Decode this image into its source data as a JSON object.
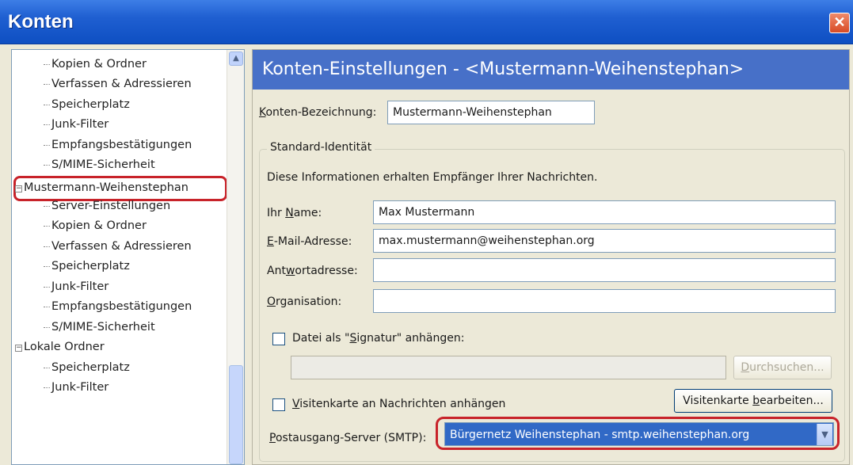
{
  "window": {
    "title": "Konten",
    "close_symbol": "✕"
  },
  "tree": {
    "items": [
      {
        "label": "Kopien & Ordner",
        "level": 1
      },
      {
        "label": "Verfassen & Adressieren",
        "level": 1
      },
      {
        "label": "Speicherplatz",
        "level": 1
      },
      {
        "label": "Junk-Filter",
        "level": 1
      },
      {
        "label": "Empfangsbestätigungen",
        "level": 1
      },
      {
        "label": "S/MIME-Sicherheit",
        "level": 1
      },
      {
        "label": "Mustermann-Weihenstephan",
        "level": 0,
        "expanded": true,
        "selected": true
      },
      {
        "label": "Server-Einstellungen",
        "level": 1
      },
      {
        "label": "Kopien & Ordner",
        "level": 1
      },
      {
        "label": "Verfassen & Adressieren",
        "level": 1
      },
      {
        "label": "Speicherplatz",
        "level": 1
      },
      {
        "label": "Junk-Filter",
        "level": 1
      },
      {
        "label": "Empfangsbestätigungen",
        "level": 1
      },
      {
        "label": "S/MIME-Sicherheit",
        "level": 1
      },
      {
        "label": "Lokale Ordner",
        "level": 0,
        "expanded": true
      },
      {
        "label": "Speicherplatz",
        "level": 1
      },
      {
        "label": "Junk-Filter",
        "level": 1
      }
    ],
    "expander_symbol": "−"
  },
  "settings": {
    "header": "Konten-Einstellungen - <Mustermann-Weihenstephan>",
    "account_name": {
      "label_pre": "K",
      "label_rest": "onten-Bezeichnung:",
      "value": "Mustermann-Weihenstephan"
    },
    "identity_group": "Standard-Identität",
    "identity_info": "Diese Informationen erhalten Empfänger Ihrer Nachrichten.",
    "name": {
      "label_pre": "Ihr ",
      "label_u": "N",
      "label_post": "ame:",
      "value": "Max Mustermann"
    },
    "email": {
      "label_u": "E",
      "label_post": "-Mail-Adresse:",
      "value": "max.mustermann@weihenstephan.org"
    },
    "reply": {
      "label_pre": "Ant",
      "label_u": "w",
      "label_post": "ortadresse:",
      "value": ""
    },
    "organisation": {
      "label_u": "O",
      "label_post": "rganisation:",
      "value": ""
    },
    "signature": {
      "label_pre": "Datei als \"",
      "label_u": "S",
      "label_post": "ignatur\" anhängen:",
      "checked": false,
      "path": ""
    },
    "browse_button": {
      "label_pre": "",
      "label_u": "D",
      "label_post": "urchsuchen..."
    },
    "vcard": {
      "label_u": "V",
      "label_post": "isitenkarte an Nachrichten anhängen",
      "checked": false
    },
    "edit_vcard_button": {
      "label_pre": "Visitenkarte ",
      "label_u": "b",
      "label_post": "earbeiten..."
    },
    "smtp": {
      "label_u": "P",
      "label_post": "ostausgang-Server (SMTP):",
      "selected": "Bürgernetz Weihenstephan - smtp.weihenstephan.org"
    }
  },
  "colors": {
    "title_bar": "#1f5fd1",
    "header_bg": "#4770c8",
    "highlight_border": "#c8232a",
    "selected_option_bg": "#3169c6"
  }
}
